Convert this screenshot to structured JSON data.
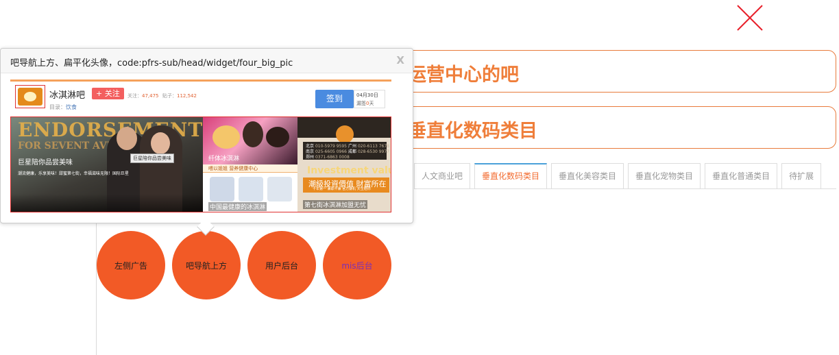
{
  "banners": [
    {
      "text": "运营中心的吧"
    },
    {
      "text": "垂直化数码类目"
    }
  ],
  "tabs": [
    {
      "label": "人文商业吧",
      "active": false
    },
    {
      "label": "垂直化数码类目",
      "active": true
    },
    {
      "label": "垂直化美容类目",
      "active": false
    },
    {
      "label": "垂直化宠物类目",
      "active": false
    },
    {
      "label": "垂直化普通类目",
      "active": false
    },
    {
      "label": "待扩展",
      "active": false
    }
  ],
  "circles": [
    {
      "label": "左侧广告"
    },
    {
      "label": "吧导航上方"
    },
    {
      "label": "用户后台"
    },
    {
      "label": "mis后台"
    }
  ],
  "popup": {
    "title": "吧导航上方、扁平化头像，code:pfrs-sub/head/widget/four_big_pic",
    "close_label": "X",
    "preview": {
      "forum_name": "冰淇淋吧",
      "follow_label": "+ 关注",
      "stats": [
        {
          "label": "关注：",
          "value": "47,475"
        },
        {
          "label": "贴子：",
          "value": "112,542"
        }
      ],
      "catalog_label": "目录：",
      "catalog_value": "饮食",
      "sign_label": "签到",
      "sign_date": "04月30日",
      "sign_streak_label": "漏签",
      "sign_streak_value": "0",
      "sign_streak_unit": "天",
      "pics": {
        "big_endorse": "ENDORSEMENT",
        "big_seven": "FOR SEVENT AVE",
        "big_caption": "巨星陪你品尝美味",
        "big_subcaption": "潮流健康，乐享美味！甜蜜第七街，幸福滋味无限！国际巨星",
        "big_tag": "巨星陪你品尝美味",
        "pic2_caption": "纤体冰淇淋",
        "pic3_header": "喂以姐姐 营养健康中心",
        "pic3_caption": "中国最健康的冰淇淋",
        "pic4_cities": [
          {
            "name": "北京",
            "phone": "010-5979 9595"
          },
          {
            "name": "南京",
            "phone": "025-6605 0966"
          },
          {
            "name": "郑州",
            "phone": "0371-6863 0008"
          },
          {
            "name": "广州",
            "phone": "020-6113 7678"
          },
          {
            "name": "成都",
            "phone": "028-6530 9977"
          }
        ],
        "pic4_invest": "Investment value",
        "pic4_slogan": "潮級投資價值 財富所在",
        "pic4_small": "十年第一 兼职不兼 官方嫌机 天生赔你",
        "pic4_caption": "第七街冰淇淋加盟无忧"
      }
    }
  },
  "colors": {
    "accent_orange": "#f25a26",
    "banner_text": "#ef7e3a",
    "tab_active_text": "#f26a2e",
    "tab_active_top": "#4aa0d9",
    "close_x": "#e8202a"
  }
}
